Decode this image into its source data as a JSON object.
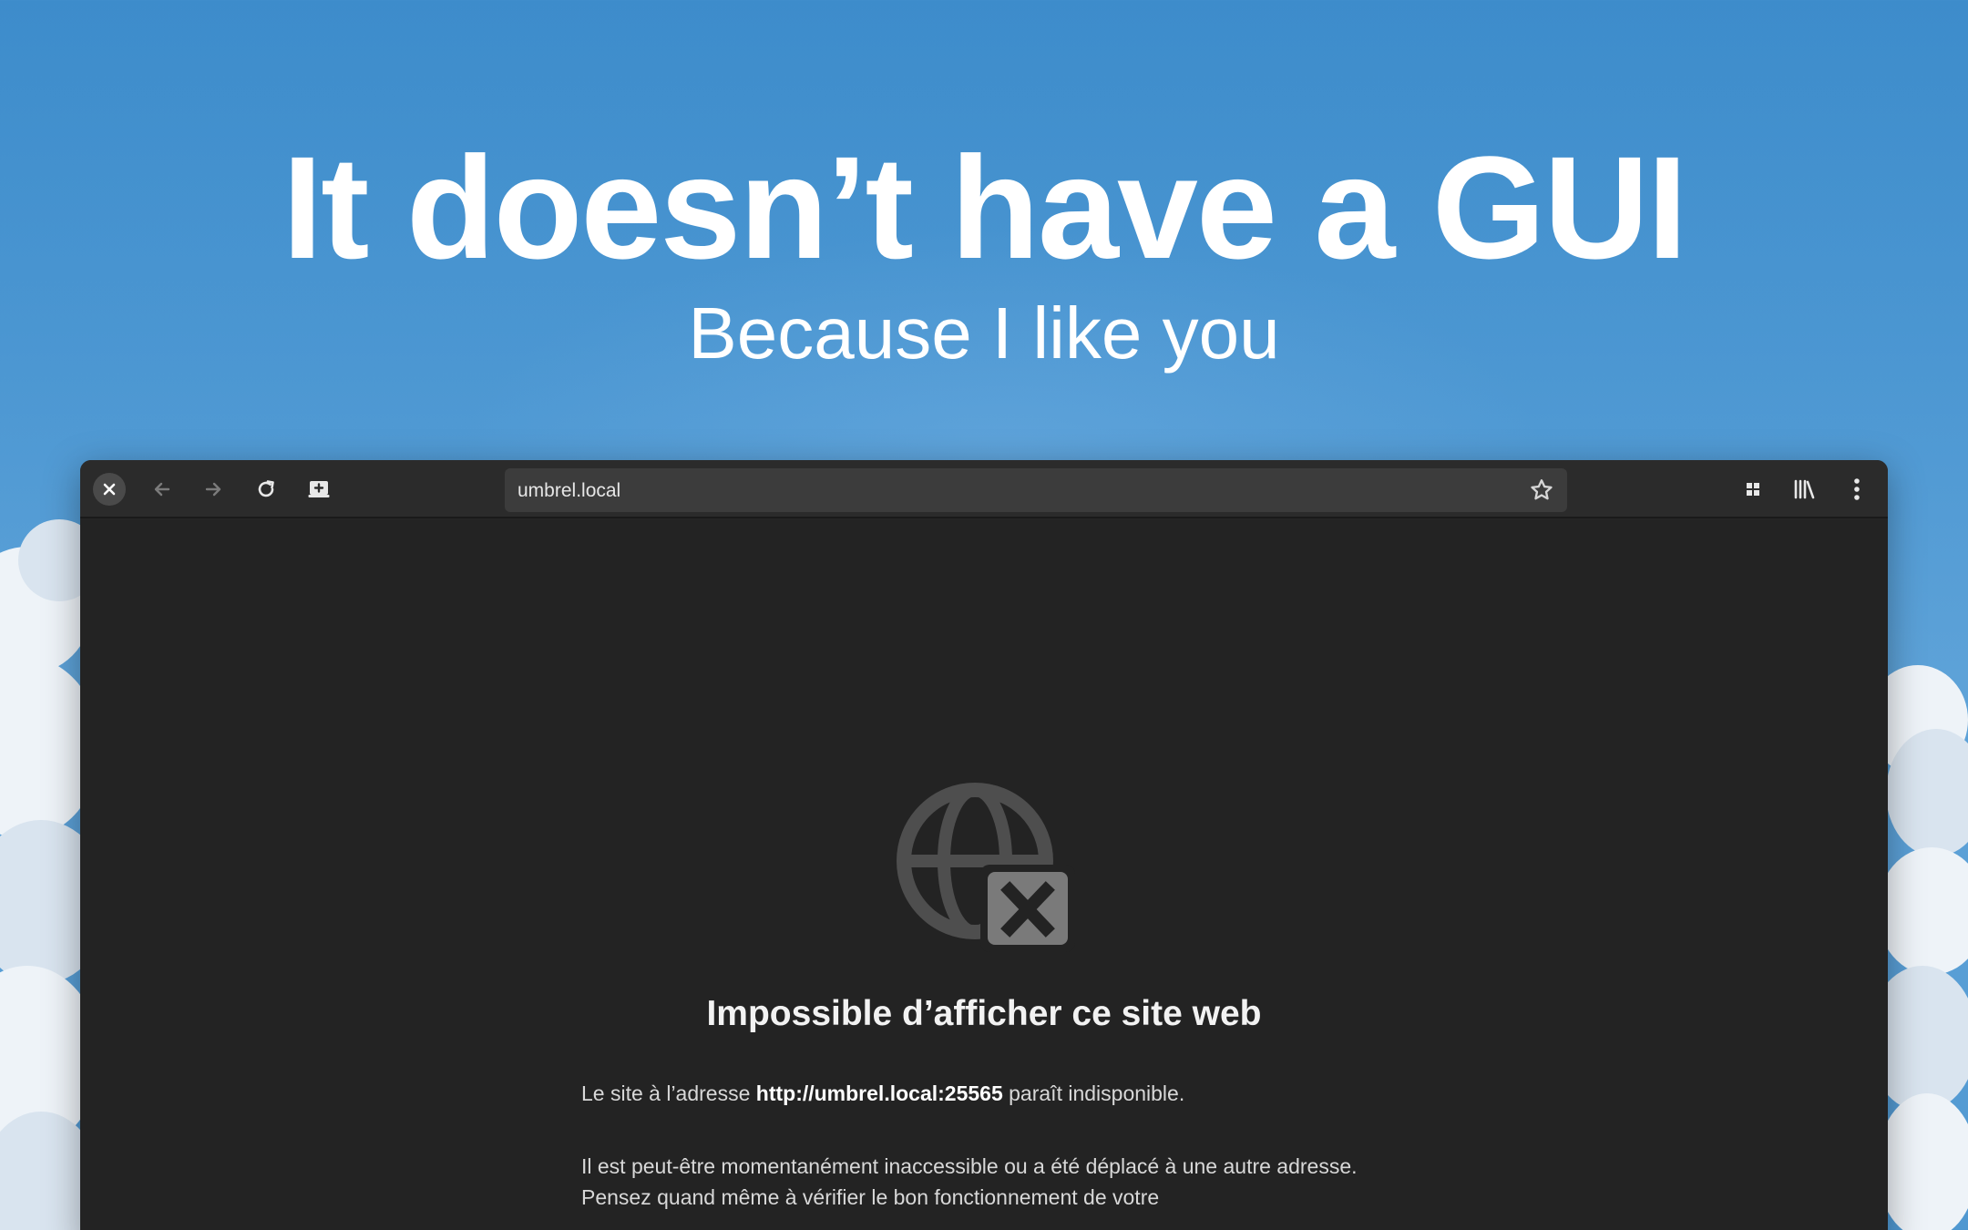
{
  "hero": {
    "title": "It doesn’t have a GUI",
    "subtitle": "Because I like you"
  },
  "browser": {
    "url": "umbrel.local",
    "icons": {
      "close": "close-icon",
      "back": "arrow-left-icon",
      "forward": "arrow-right-icon",
      "reload": "reload-icon",
      "new_tab": "add-tab-icon",
      "bookmark": "star-icon",
      "apps": "grid-icon",
      "library": "library-icon",
      "menu": "kebab-menu-icon"
    }
  },
  "error": {
    "title": "Impossible d’afficher ce site web",
    "line1_prefix": "Le site à l’adresse ",
    "line1_url": "http://umbrel.local:25565",
    "line1_suffix": " paraît indisponible.",
    "line2": "Il est peut-être momentanément inaccessible ou a été déplacé à une autre adresse. Pensez quand même à vérifier le bon fonctionnement de votre"
  },
  "colors": {
    "sky": "#4c97d2",
    "browser_bg": "#232323",
    "toolbar_bg": "#2b2b2b",
    "urlbar_bg": "#3c3c3c"
  }
}
